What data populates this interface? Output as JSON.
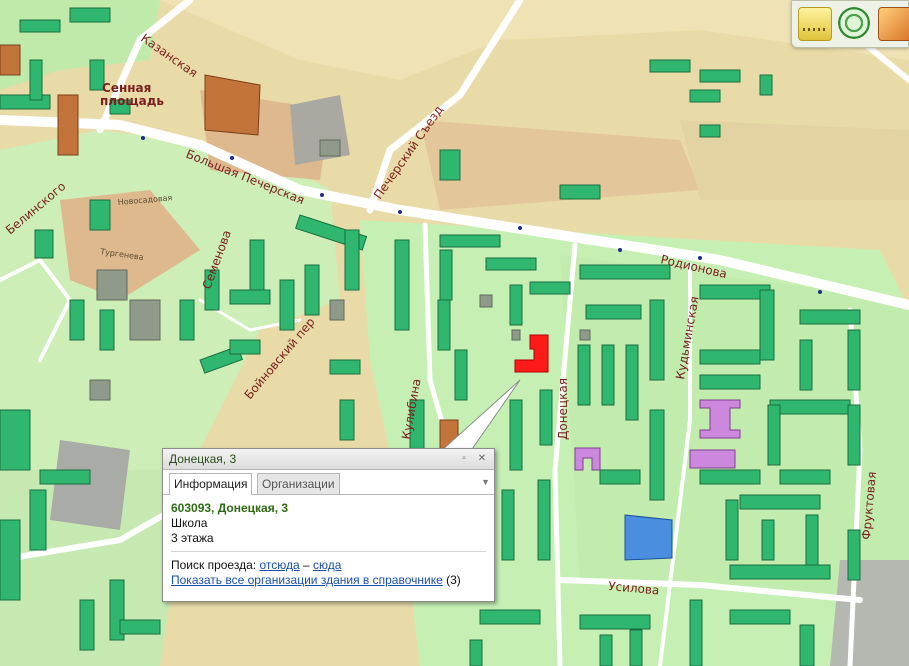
{
  "map": {
    "streets": {
      "kazanskaya": "Казанская",
      "bolshaya_pecherskaya": "Большая Печерская",
      "pecherskiy_sezd": "Печерский Съезд",
      "rodionova": "Родионова",
      "belinskogo": "Белинского",
      "semenova": "Семенова",
      "boynovskiy": "Бойновский пер",
      "donetskaya": "Донецкая",
      "kudminskaya": "Кудьминская",
      "usilova": "Усилова",
      "fruktovaya": "Фруктовая",
      "kulibina": "Кулибина",
      "turgeneva": "Тургенева",
      "novosadovaya": "Новосадовая"
    },
    "square": [
      "Сенная",
      "площадь"
    ],
    "selected_building_color": "#ff1a1a"
  },
  "toolbar": {
    "ruler_icon": "ruler-icon",
    "radar_icon": "radar-icon",
    "layers_icon": "layers-icon"
  },
  "popup": {
    "title": "Донецкая, 3",
    "tabs": [
      "Информация",
      "Организации"
    ],
    "address": "603093, Донецкая, 3",
    "type": "Школа",
    "floors": "3 этажа",
    "route_label": "Поиск проезда:",
    "route_from": "отсюда",
    "route_dash": " – ",
    "route_to": "сюда",
    "show_orgs_link": "Показать все организации здания в справочнике",
    "orgs_count": " (3)"
  }
}
